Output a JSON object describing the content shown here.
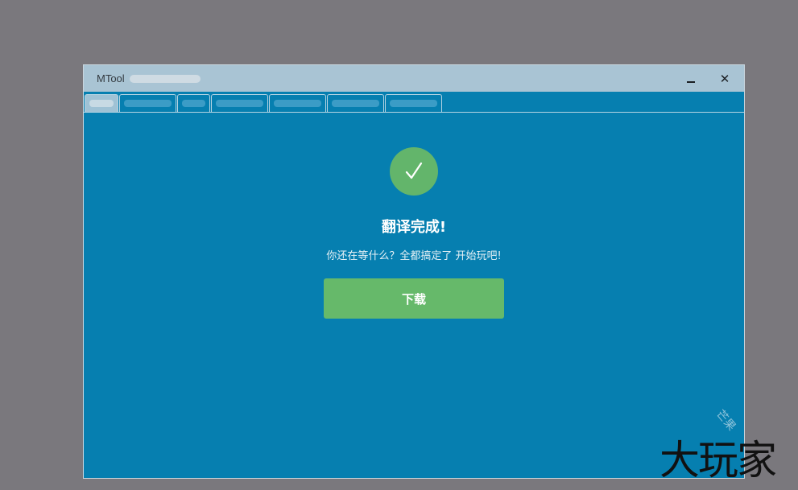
{
  "window": {
    "title": "MTool",
    "minimize_symbol": "",
    "close_symbol": "✕"
  },
  "tabs": [
    {
      "active": true
    },
    {
      "active": false
    },
    {
      "active": false
    },
    {
      "active": false
    },
    {
      "active": false
    },
    {
      "active": false
    },
    {
      "active": false
    }
  ],
  "result": {
    "icon": "checkmark-icon",
    "title": "翻译完成!",
    "subtitle": "你还在等什么？全都搞定了 开始玩吧!",
    "download_label": "下载"
  },
  "watermark": {
    "text": "大玩家",
    "small_text": "芒果"
  },
  "colors": {
    "background": "#7a787d",
    "window_body": "#067fb0",
    "titlebar": "#a9c4d4",
    "success_green": "#63b56b",
    "button_green": "#66b96a"
  }
}
